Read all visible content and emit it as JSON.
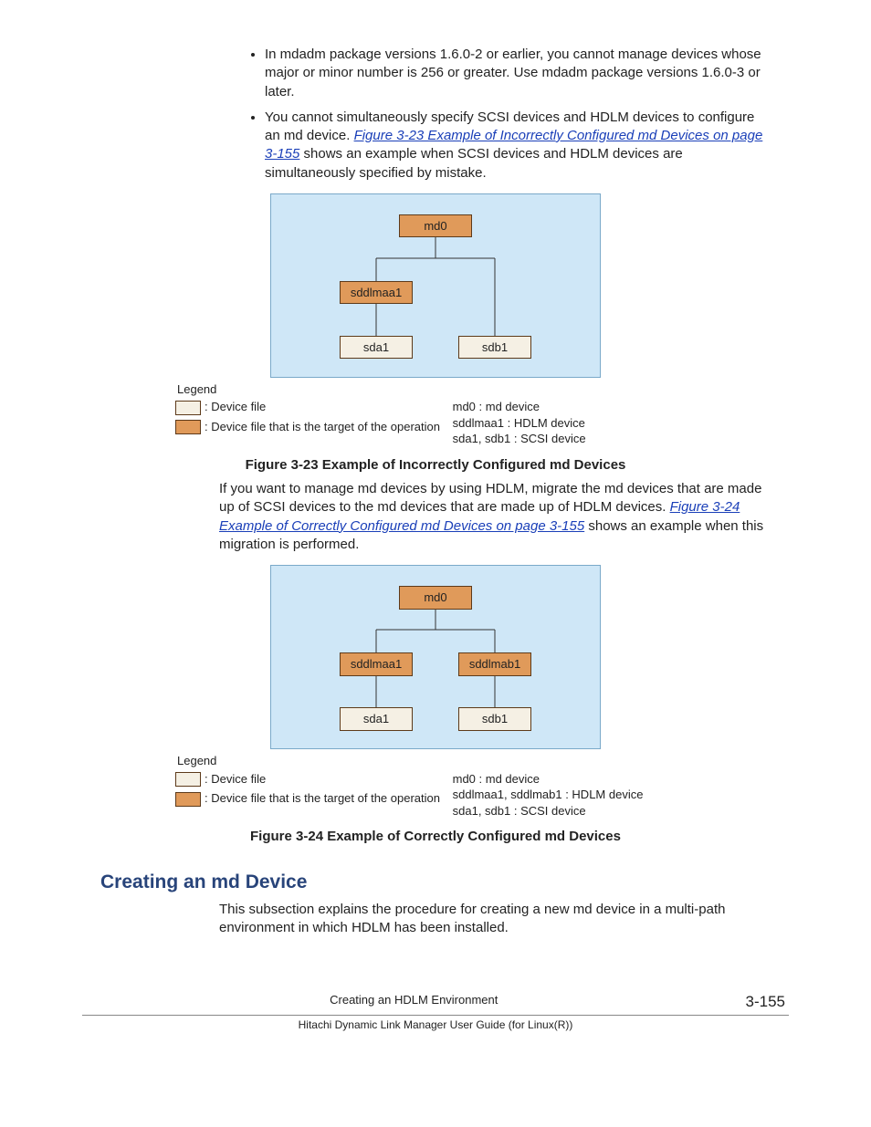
{
  "bullets": {
    "b1": "In mdadm package versions 1.6.0-2 or earlier, you cannot manage devices whose major or minor number is 256 or greater. Use mdadm package versions 1.6.0-3 or later.",
    "b2_pre": "You cannot simultaneously specify SCSI devices and HDLM devices to configure an md device. ",
    "b2_link": "Figure 3-23 Example of Incorrectly Configured md Devices on page 3-155",
    "b2_post": " shows an example when SCSI devices and HDLM devices are simultaneously specified by mistake."
  },
  "fig23": {
    "caption": "Figure 3-23 Example of Incorrectly Configured md Devices",
    "nodes": {
      "md0": "md0",
      "sddlmaa1": "sddlmaa1",
      "sda1": "sda1",
      "sdb1": "sdb1"
    }
  },
  "para1_pre": "If you want to manage md devices by using HDLM, migrate the md devices that are made up of SCSI devices to the md devices that are made up of HDLM devices. ",
  "para1_link": "Figure 3-24 Example of Correctly Configured md Devices on page 3-155",
  "para1_post": " shows an example when this migration is performed.",
  "fig24": {
    "caption": "Figure 3-24 Example of Correctly Configured md Devices",
    "nodes": {
      "md0": "md0",
      "sddlmaa1": "sddlmaa1",
      "sddlmab1": "sddlmab1",
      "sda1": "sda1",
      "sdb1": "sdb1"
    }
  },
  "legend": {
    "title": "Legend",
    "plain": ": Device file",
    "target": ": Device file that is the target of the operation",
    "r1": "md0 : md device",
    "r2_23": "sddlmaa1 : HDLM device",
    "r2_24": "sddlmaa1, sddlmab1 : HDLM device",
    "r3": "sda1, sdb1 : SCSI device"
  },
  "section": "Creating an md Device",
  "section_para": "This subsection explains the procedure for creating a new md device in a multi-path environment in which HDLM has been installed.",
  "footer": {
    "chapter": "Creating an HDLM Environment",
    "page": "3-155",
    "book": "Hitachi Dynamic Link Manager User Guide (for Linux(R))"
  }
}
